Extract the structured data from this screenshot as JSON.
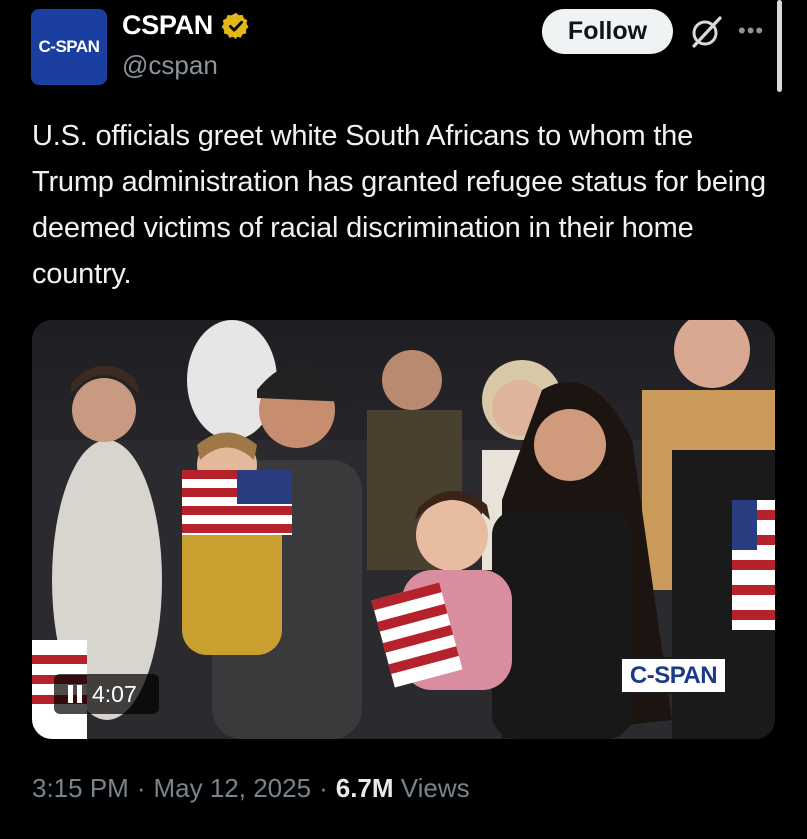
{
  "account": {
    "avatar_text": "C-SPAN",
    "display_name": "CSPAN",
    "handle": "@cspan",
    "verified_icon": "gold-verified-badge-icon"
  },
  "actions": {
    "follow_label": "Follow",
    "grok_icon": "grok-icon",
    "more_icon": "more-options-icon"
  },
  "tweet": {
    "text": "U.S. officials greet white South Africans to whom the Trump administration has granted refugee status for being deemed victims of racial discrimination in their home country."
  },
  "media": {
    "type": "video",
    "duration": "4:07",
    "playback_state": "playing",
    "watermark": "C-SPAN"
  },
  "meta": {
    "time": "3:15 PM",
    "date": "May 12, 2025",
    "separator": "·",
    "views_count": "6.7M",
    "views_label": "Views"
  },
  "colors": {
    "background": "#000000",
    "follow_button": "#eff3f4",
    "verified_gold": "#e2b719",
    "cspan_blue": "#1b3fa0",
    "secondary_text": "#7a838b"
  }
}
